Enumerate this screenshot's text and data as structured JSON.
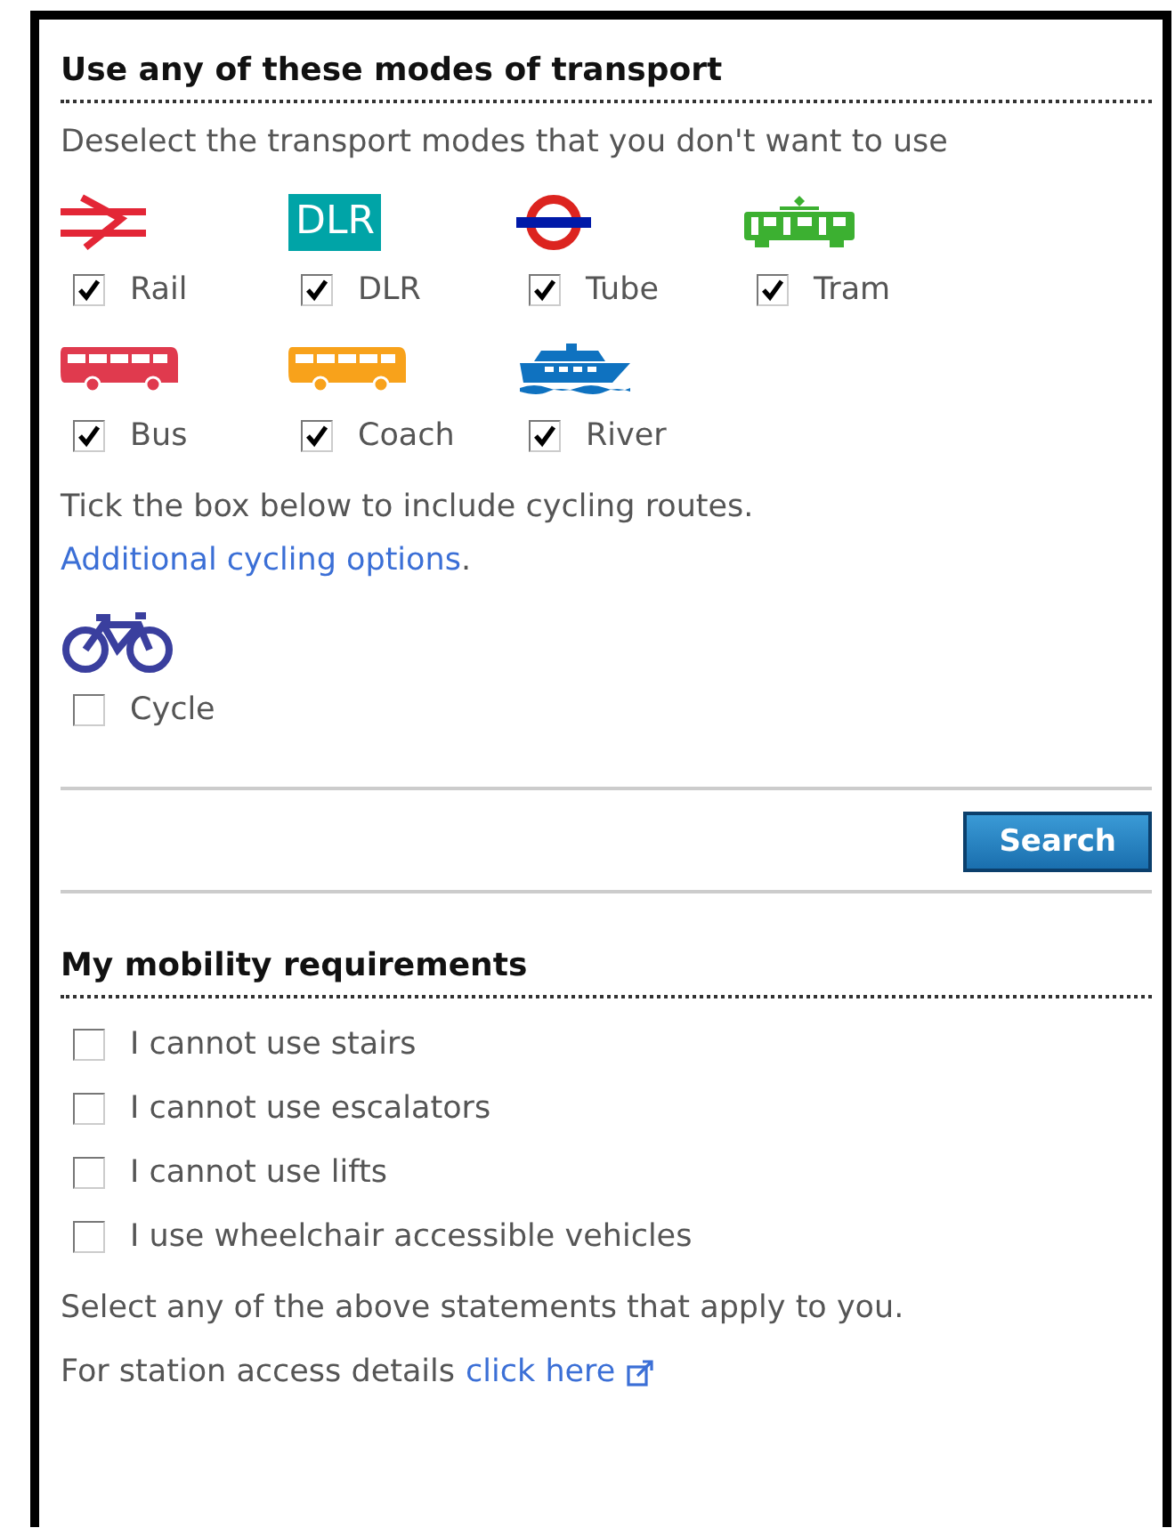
{
  "transport": {
    "title": "Use any of these modes of transport",
    "instruction": "Deselect the transport modes that you don't want to use",
    "modes": [
      {
        "kind": "rail",
        "label": "Rail",
        "checked": true
      },
      {
        "kind": "dlr",
        "logo_text": "DLR",
        "label": "DLR",
        "checked": true
      },
      {
        "kind": "tube",
        "label": "Tube",
        "checked": true
      },
      {
        "kind": "tram",
        "label": "Tram",
        "checked": true
      },
      {
        "kind": "bus",
        "label": "Bus",
        "checked": true
      },
      {
        "kind": "coach",
        "label": "Coach",
        "checked": true
      },
      {
        "kind": "river",
        "label": "River",
        "checked": true
      }
    ],
    "cycling_note": "Tick the box below to include cycling routes.",
    "cycling_link": "Additional cycling options",
    "cycling_note_end": ".",
    "cycle": {
      "kind": "cycle",
      "label": "Cycle",
      "checked": false
    }
  },
  "search_button": "Search",
  "mobility": {
    "title": "My mobility requirements",
    "options": [
      {
        "label": "I cannot use stairs",
        "checked": false
      },
      {
        "label": "I cannot use escalators",
        "checked": false
      },
      {
        "label": "I cannot use lifts",
        "checked": false
      },
      {
        "label": "I use wheelchair accessible vehicles",
        "checked": false
      }
    ],
    "note": "Select any of the above statements that apply to you.",
    "access_text": "For station access details",
    "access_link": "click here"
  }
}
